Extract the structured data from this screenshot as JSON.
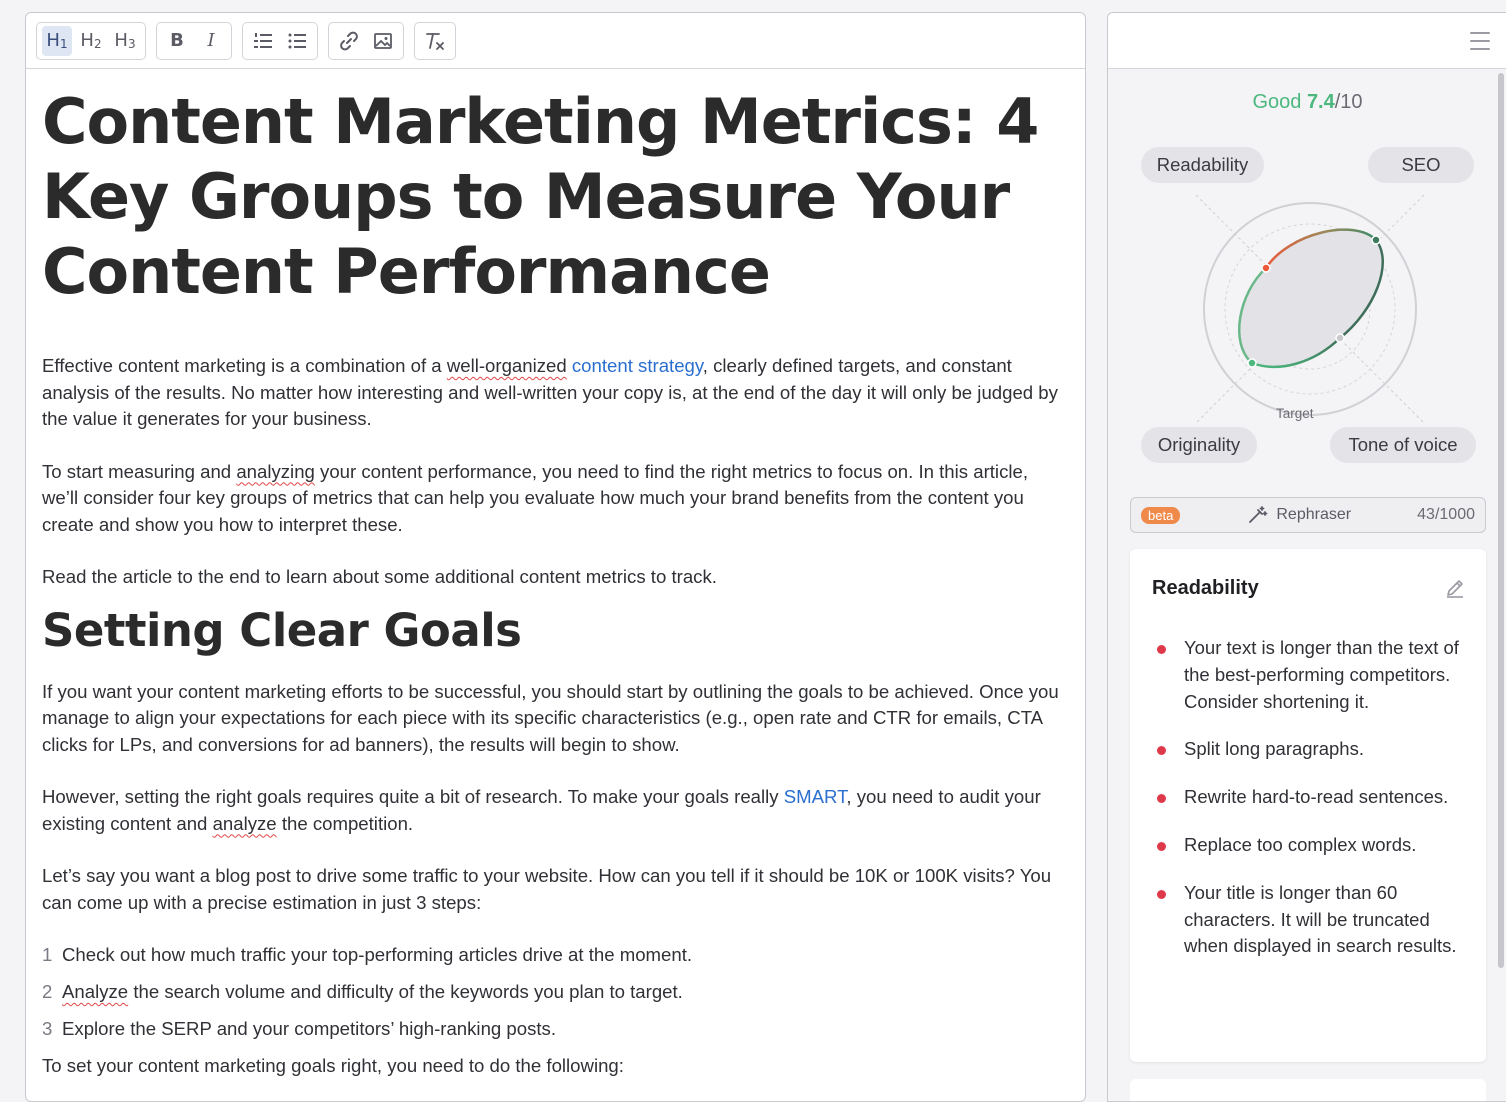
{
  "toolbar": {
    "headings": [
      {
        "letter": "H",
        "sub": "1"
      },
      {
        "letter": "H",
        "sub": "2"
      },
      {
        "letter": "H",
        "sub": "3"
      }
    ],
    "bold": "B",
    "italic": "I"
  },
  "article": {
    "title": "Content Marketing Metrics: 4 Key Groups to Measure Your Content Performance",
    "p1_a": "Effective content marketing is a combination of a ",
    "p1_spell": "well-organized",
    "p1_b": " ",
    "p1_link": "content strategy",
    "p1_c": ", clearly defined targets, and constant analysis of the results. No matter how interesting and well-written your copy is, at the end of the day it will only be judged by the value it generates for your business.",
    "p2_a": "To start measuring and ",
    "p2_spell": "analyzing",
    "p2_b": " your content performance, you need to find the right metrics to focus on. In this article, we’ll consider four key groups of metrics that can help you evaluate how much your brand benefits from the content you create and show you how to interpret these.",
    "p3": "Read the article to the end to learn about some additional content metrics to track.",
    "h2": "Setting Clear Goals",
    "p4": "If you want your content marketing efforts to be successful, you should start by outlining the goals to be achieved. Once you manage to align your expectations for each piece with its specific characteristics (e.g., open rate and CTR for emails, CTA clicks for LPs, and conversions for ad banners), the results will begin to show.",
    "p5_a": "However, setting the right goals requires quite a bit of research. To make your goals really ",
    "p5_link": "SMART",
    "p5_b": ", you need to audit your existing content and ",
    "p5_spell": "analyze",
    "p5_c": " the competition.",
    "p6": "Let’s say you want a blog post to drive some traffic to your website. How can you tell if it should be 10K or 100K visits? You can come up with a precise estimation in just 3 steps:",
    "steps": [
      {
        "num": "1",
        "text": "Check out how much traffic your top-performing articles drive at the moment."
      },
      {
        "num": "2",
        "spell": "Analyze",
        "text": " the search volume and difficulty of the keywords you plan to target."
      },
      {
        "num": "3",
        "text": "Explore the SERP and your competitors’ high-ranking posts."
      }
    ],
    "p7": "To set your content marketing goals right, you need to do the following:"
  },
  "sidebar": {
    "score_label": "Good",
    "score_value": "7.4",
    "score_max": "/10",
    "axes": {
      "readability": "Readability",
      "seo": "SEO",
      "originality": "Originality",
      "tone": "Tone of voice"
    },
    "target_label": "Target",
    "rephraser": {
      "badge": "beta",
      "label": "Rephraser",
      "count": "43/1000"
    },
    "card": {
      "title": "Readability",
      "issues": [
        "Your text is longer than the text of the best-performing competitors. Consider shortening it.",
        "Split long paragraphs.",
        "Rewrite hard-to-read sentences.",
        "Replace too complex words.",
        "Your title is longer than 60 characters. It will be truncated when displayed in search results."
      ]
    }
  },
  "colors": {
    "accent_green": "#4cb87e",
    "link_blue": "#2a6fcf",
    "issue_red": "#e0384b",
    "beta_orange": "#f08a4b"
  }
}
